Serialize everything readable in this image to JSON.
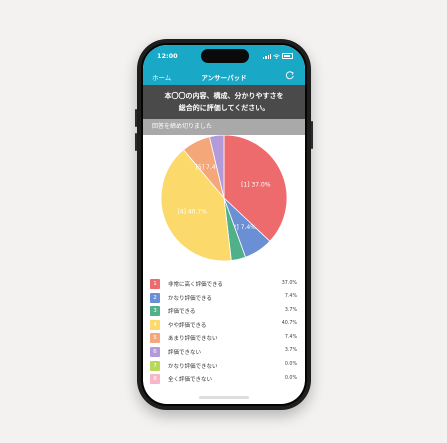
{
  "status_bar": {
    "time": "12:00"
  },
  "nav": {
    "home_label": "ホーム",
    "title": "アンサーパッド"
  },
  "question": {
    "line1": "本〇〇の内容、構成、分かりやすさを",
    "line2": "総合的に評価してください。"
  },
  "closed_notice": "回答を締め切りました",
  "chart_data": {
    "type": "pie",
    "categories": [
      "非常に高く評価できる",
      "かなり評価できる",
      "評価できる",
      "やや評価できる",
      "あまり評価できない",
      "評価できない",
      "かなり評価できない",
      "全く評価できない"
    ],
    "values": [
      37.0,
      7.4,
      3.7,
      40.7,
      7.4,
      3.7,
      0.0,
      0.0
    ],
    "slice_labels": [
      "[1] 37.0%",
      "[2] 7.4%",
      "",
      "[4] 40.7%",
      "[5] 7.4%",
      "",
      "",
      ""
    ],
    "colors": [
      "#ee6b6d",
      "#6b8fd4",
      "#4fb08a",
      "#fbd96a",
      "#f4a87a",
      "#b39ad8",
      "#b9d85a",
      "#f7b7c8"
    ]
  },
  "legend": [
    {
      "num": "1",
      "label": "非常に高く評価できる",
      "pct": "37.0%"
    },
    {
      "num": "2",
      "label": "かなり評価できる",
      "pct": "7.4%"
    },
    {
      "num": "3",
      "label": "評価できる",
      "pct": "3.7%"
    },
    {
      "num": "4",
      "label": "やや評価できる",
      "pct": "40.7%"
    },
    {
      "num": "5",
      "label": "あまり評価できない",
      "pct": "7.4%"
    },
    {
      "num": "6",
      "label": "評価できない",
      "pct": "3.7%"
    },
    {
      "num": "7",
      "label": "かなり評価できない",
      "pct": "0.0%"
    },
    {
      "num": "8",
      "label": "全く評価できない",
      "pct": "0.0%"
    }
  ]
}
